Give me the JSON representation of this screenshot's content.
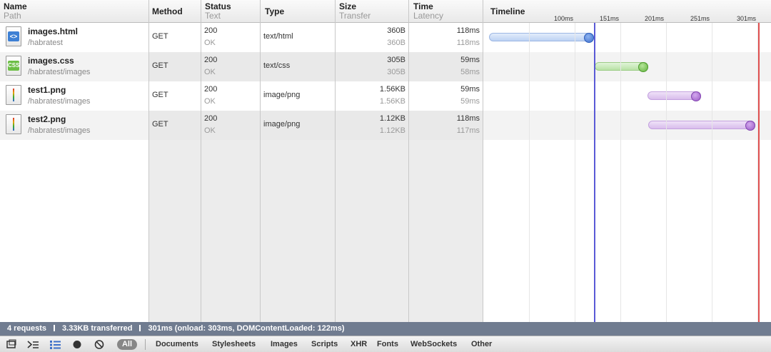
{
  "header": {
    "name": "Name",
    "path": "Path",
    "method": "Method",
    "status": "Status",
    "text": "Text",
    "type": "Type",
    "size": "Size",
    "transfer": "Transfer",
    "time": "Time",
    "latency": "Latency",
    "timeline": "Timeline",
    "ticks": [
      "100ms",
      "151ms",
      "201ms",
      "251ms",
      "301ms"
    ]
  },
  "rows": [
    {
      "name": "images.html",
      "path": "/habratest",
      "icon": "html-file-icon",
      "method": "GET",
      "status": "200",
      "status_text": "OK",
      "type": "text/html",
      "size": "360B",
      "transfer": "360B",
      "time": "118ms",
      "latency": "118ms",
      "bar_color": "blue",
      "bar_start_ms": 2,
      "bar_end_ms": 118
    },
    {
      "name": "images.css",
      "path": "/habratest/images",
      "icon": "css-file-icon",
      "method": "GET",
      "status": "200",
      "status_text": "OK",
      "type": "text/css",
      "size": "305B",
      "transfer": "305B",
      "time": "59ms",
      "latency": "58ms",
      "bar_color": "green",
      "bar_start_ms": 119,
      "bar_end_ms": 178
    },
    {
      "name": "test1.png",
      "path": "/habratest/images",
      "icon": "image-file-icon",
      "method": "GET",
      "status": "200",
      "status_text": "OK",
      "type": "image/png",
      "size": "1.56KB",
      "transfer": "1.56KB",
      "time": "59ms",
      "latency": "59ms",
      "bar_color": "purple",
      "bar_start_ms": 177,
      "bar_end_ms": 236
    },
    {
      "name": "test2.png",
      "path": "/habratest/images",
      "icon": "image-file-icon",
      "method": "GET",
      "status": "200",
      "status_text": "OK",
      "type": "image/png",
      "size": "1.12KB",
      "transfer": "1.12KB",
      "time": "118ms",
      "latency": "117ms",
      "bar_color": "purple",
      "bar_start_ms": 178,
      "bar_end_ms": 296
    }
  ],
  "markers": {
    "dom_content_loaded_ms": 119,
    "onload_ms": 300
  },
  "summary": {
    "requests": "4 requests",
    "transferred": "3.33KB transferred",
    "timing": "301ms (onload: 303ms, DOMContentLoaded: 122ms)"
  },
  "toolbar": {
    "all": "All",
    "filters": [
      "Documents",
      "Stylesheets",
      "Images",
      "Scripts",
      "XHR",
      "Fonts",
      "WebSockets",
      "Other"
    ]
  },
  "colors": {
    "dcl_line": "#5a5ad6",
    "load_line": "#e05050",
    "summary_bg": "#707c90"
  }
}
